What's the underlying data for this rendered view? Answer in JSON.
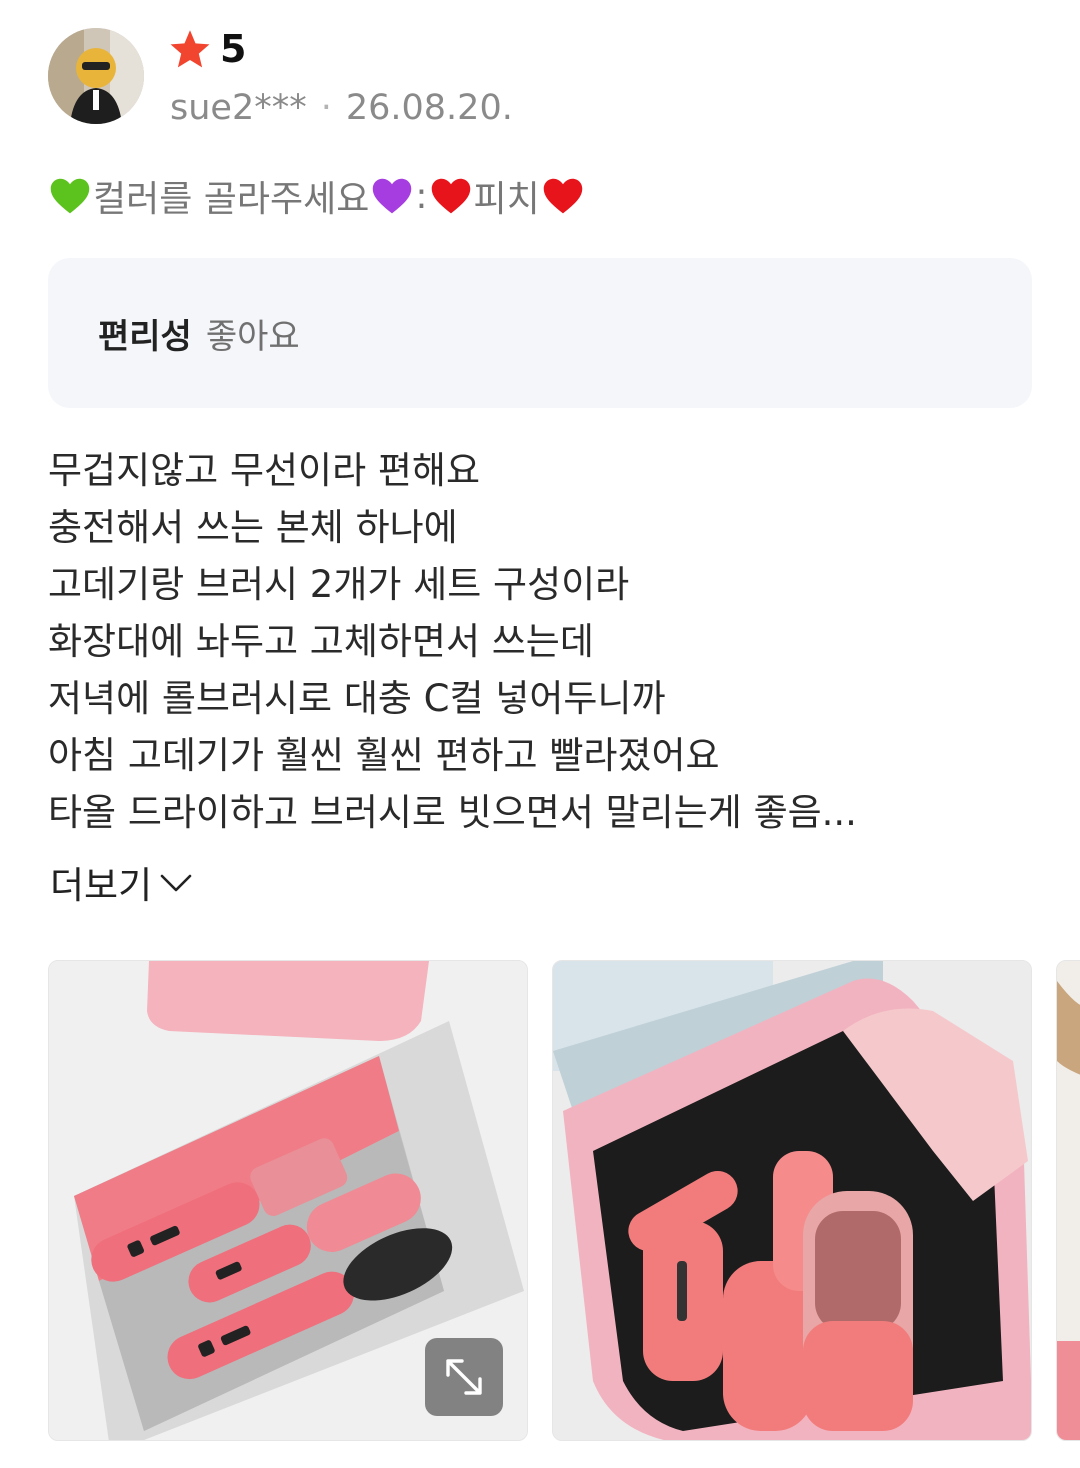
{
  "review": {
    "rating": "5",
    "username": "sue2***",
    "date": "26.08.20.",
    "option": {
      "prefix": "컬러를 골라주세요",
      "separator": ":",
      "value": "피치"
    },
    "survey": {
      "question": "편리성",
      "answer": "좋아요"
    },
    "body_lines": [
      "무겁지않고 무선이라 편해요",
      "충전해서 쓰는 본체 하나에",
      "고데기랑 브러시 2개가 세트 구성이라",
      "화장대에 놔두고 고체하면서 쓰는데",
      "저녁에 롤브러시로 대충 C컬 넣어두니까",
      "아침 고데기가 훨씬 훨씬 편하고 빨라졌어요",
      "타올 드라이하고 브러시로 빗으면서 말리는게 좋음..."
    ],
    "more_label": "더보기"
  },
  "icons": {
    "star": "star-icon",
    "option_hearts": [
      "green-heart-icon",
      "purple-heart-icon",
      "red-heart-icon",
      "red-heart-icon"
    ],
    "more": "chevron-down-icon",
    "expand": "expand-icon"
  },
  "colors": {
    "star": "#f2452f",
    "product_pink": "#ef7c86",
    "survey_bg": "#f4f6fa"
  }
}
